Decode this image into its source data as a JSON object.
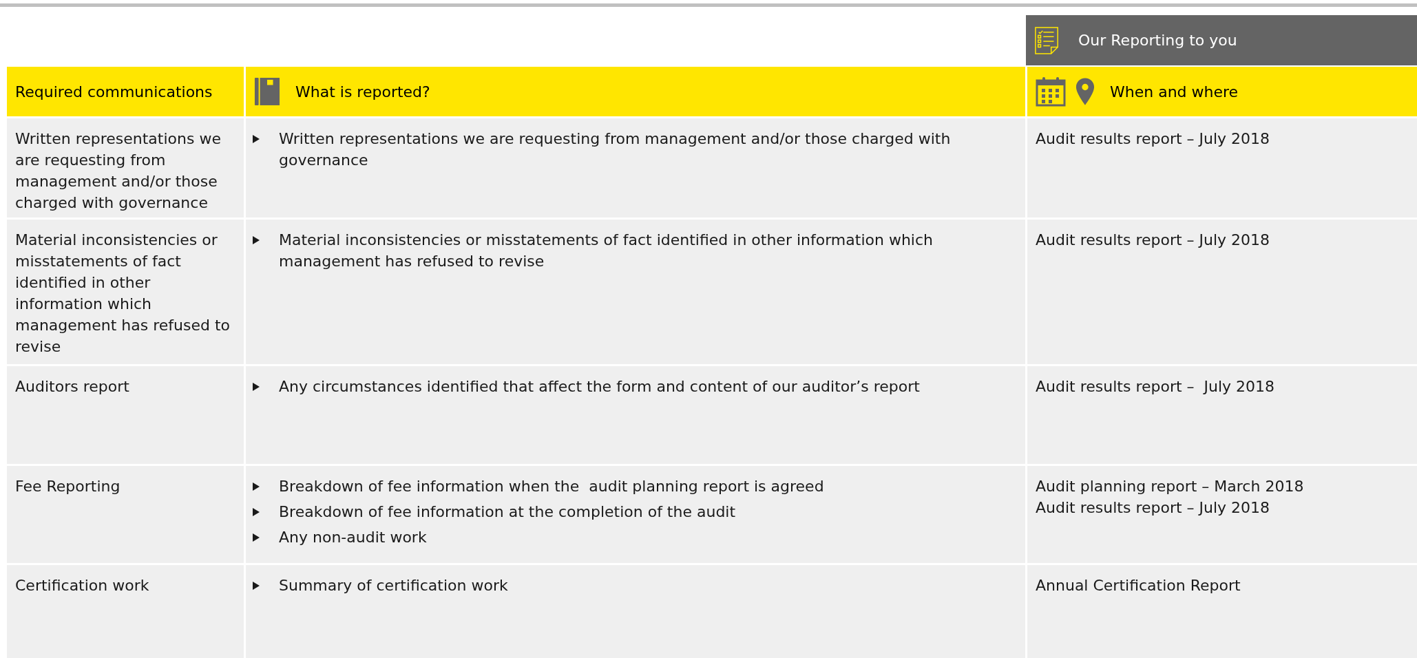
{
  "banner": {
    "title": "Our Reporting to you"
  },
  "table": {
    "columns": [
      {
        "label": "Required communications"
      },
      {
        "label": "What is reported?"
      },
      {
        "label": "When and where"
      }
    ],
    "rows": [
      {
        "communication": "Written representations we are requesting from management and/or those charged with governance",
        "reported": [
          "Written representations we are requesting from management and/or those charged with governance"
        ],
        "when_where": [
          "Audit results report – July 2018"
        ]
      },
      {
        "communication": "Material inconsistencies or misstatements of fact identified in other information which management has refused to revise",
        "reported": [
          "Material inconsistencies or misstatements of fact identified in other information which management has refused to revise"
        ],
        "when_where": [
          "Audit results report – July 2018"
        ]
      },
      {
        "communication": "Auditors report",
        "reported": [
          "Any circumstances identified that affect the form and content of our auditor’s report"
        ],
        "when_where": [
          "Audit results report –  July 2018"
        ]
      },
      {
        "communication": "Fee Reporting",
        "reported": [
          "Breakdown of fee information when the  audit planning report is agreed",
          "Breakdown of fee information at the completion of the audit",
          "Any non-audit work"
        ],
        "when_where": [
          "Audit planning report – March 2018",
          "Audit results report – July 2018"
        ]
      },
      {
        "communication": "Certification work",
        "reported": [
          "Summary of certification work"
        ],
        "when_where": [
          "Annual Certification Report"
        ]
      }
    ]
  }
}
